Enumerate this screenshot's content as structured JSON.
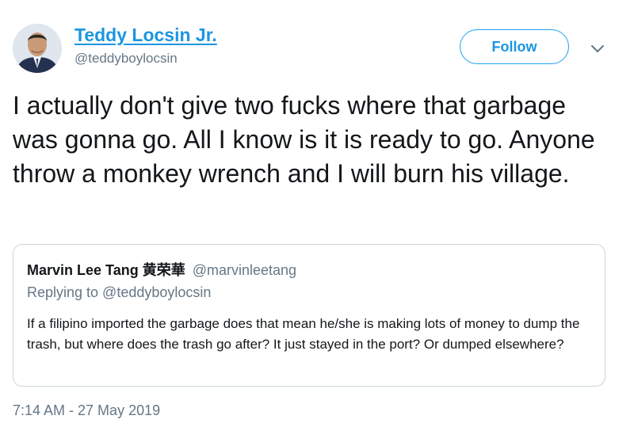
{
  "author": {
    "display_name": "Teddy Locsin Jr.",
    "handle": "@teddyboylocsin",
    "avatar": "profile-photo"
  },
  "actions": {
    "follow_label": "Follow",
    "more_icon": "chevron-down-icon"
  },
  "tweet": {
    "text": "I actually don't give two fucks where that garbage was gonna go. All I know is it is ready to go. Anyone throw a monkey wrench and I will burn his village.",
    "timestamp": "7:14 AM - 27 May 2019"
  },
  "quoted_tweet": {
    "display_name": "Marvin Lee Tang 黄荣華",
    "handle": "@marvinleetang",
    "replying_to": "Replying to @teddyboylocsin",
    "text": "If a filipino imported the garbage does that mean he/she is making lots of money to dump the trash, but where does the trash go after? It just stayed in the port? Or dumped elsewhere?"
  },
  "colors": {
    "link_blue": "#1b95e0",
    "secondary_text": "#657786",
    "border": "#ccd6dd",
    "primary_text": "#14171a"
  }
}
